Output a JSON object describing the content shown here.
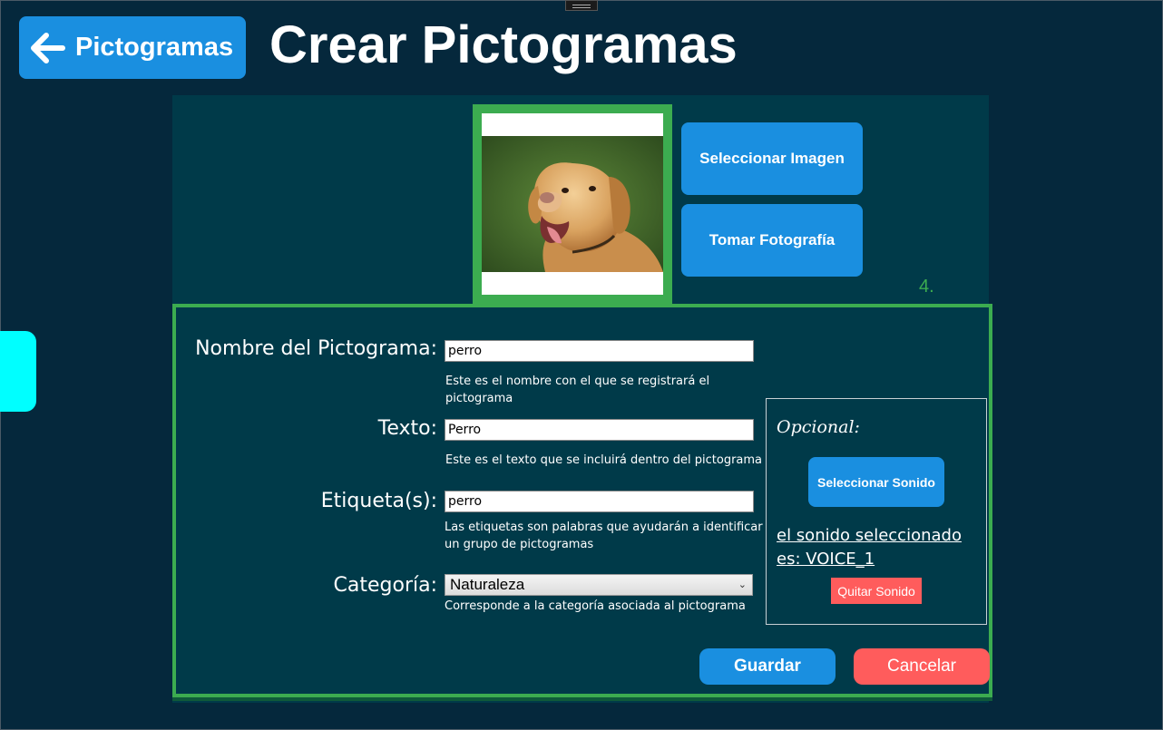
{
  "header": {
    "back_label": "Pictogramas",
    "title": "Crear Pictogramas"
  },
  "image_section": {
    "select_image_label": "Seleccionar Imagen",
    "take_photo_label": "Tomar Fotografía",
    "step_label": "4."
  },
  "form": {
    "name": {
      "label": "Nombre del Pictograma:",
      "value": "perro",
      "hint": "Este es el nombre con el que se registrará el pictograma"
    },
    "text": {
      "label": "Texto:",
      "value": "Perro",
      "hint": "Este es el texto que se incluirá dentro del pictograma"
    },
    "tags": {
      "label": "Etiqueta(s):",
      "value": "perro",
      "hint": "Las etiquetas son palabras que ayudarán a identificar un grupo de pictogramas"
    },
    "category": {
      "label": "Categoría:",
      "selected": "Naturaleza",
      "hint": "Corresponde a la categoría asociada al pictograma"
    }
  },
  "sound": {
    "optional_label": "Opcional:",
    "select_sound_label": "Seleccionar Sonido",
    "status_text": "el sonido seleccionado es: VOICE_1",
    "remove_label": "Quitar Sonido"
  },
  "actions": {
    "save_label": "Guardar",
    "cancel_label": "Cancelar"
  },
  "colors": {
    "background": "#05283c",
    "panel": "#003a49",
    "accent_blue": "#1a8fe0",
    "accent_green": "#3cac50",
    "danger_red": "#ff5c5c",
    "side_tab": "#00ffff"
  }
}
